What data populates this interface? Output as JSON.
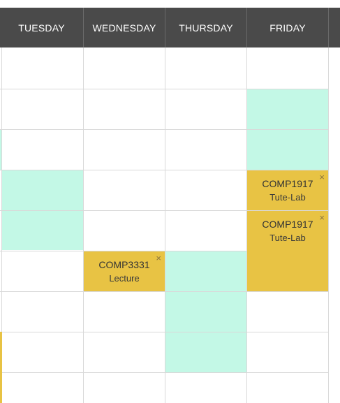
{
  "headers": [
    {
      "label": "TUESDAY"
    },
    {
      "label": "WEDNESDAY"
    },
    {
      "label": "THURSDAY"
    },
    {
      "label": "FRIDAY"
    }
  ],
  "classes": [
    {
      "code": "COMP1917",
      "type": "Tute-Lab",
      "day": "Friday",
      "close_icon": "×"
    },
    {
      "code": "COMP1917",
      "type": "Tute-Lab",
      "day": "Friday",
      "close_icon": "×"
    },
    {
      "code": "COMP3331",
      "type": "Lecture",
      "day": "Wednesday",
      "close_icon": "×"
    }
  ],
  "colors": {
    "header_bg": "#4a4a4a",
    "available_slot": "#c3f8e6",
    "class_block": "#e8c344",
    "grid_line": "#d9d9d9"
  }
}
